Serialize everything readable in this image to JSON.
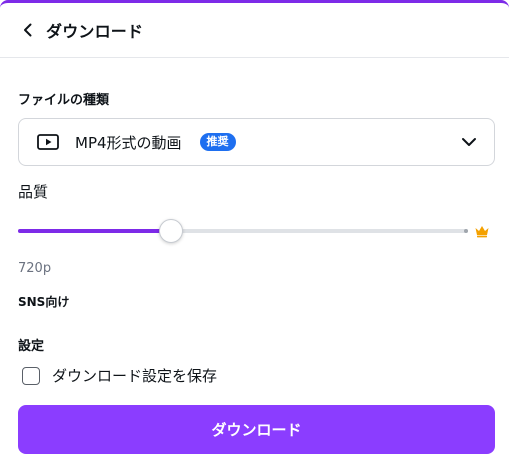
{
  "header": {
    "title": "ダウンロード"
  },
  "file_type": {
    "label": "ファイルの種類",
    "selected_value": "MP4形式の動画",
    "badge": "推奨"
  },
  "quality": {
    "label": "品質",
    "slider_fraction": 0.34,
    "resolution": "720p",
    "note": "SNS向け"
  },
  "settings": {
    "label": "設定",
    "save_settings_label": "ダウンロード設定を保存",
    "save_settings_checked": false
  },
  "actions": {
    "download_label": "ダウンロード"
  },
  "colors": {
    "accent": "#8b3dff",
    "top_border": "#7d2ae8",
    "badge": "#1e6ff0",
    "crown": "#f4a100"
  },
  "icons": {
    "back": "chevron-left-icon",
    "video": "play-icon",
    "dropdown": "chevron-down-icon",
    "premium": "crown-icon"
  }
}
